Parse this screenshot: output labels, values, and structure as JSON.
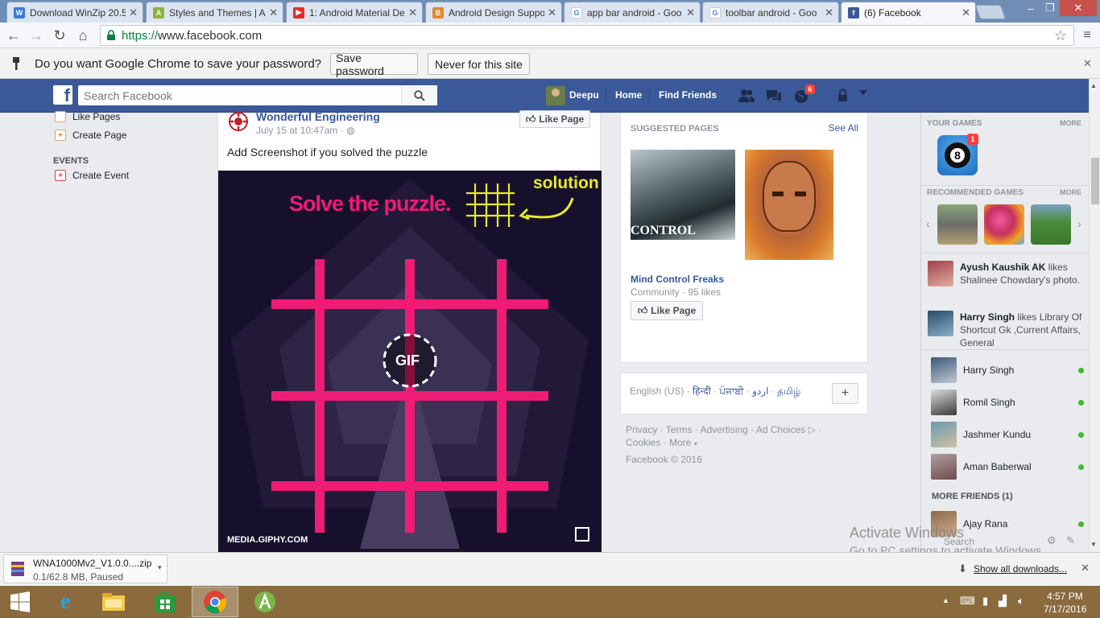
{
  "browser": {
    "tabs": [
      {
        "label": "Download WinZip 20.5",
        "icon": "winzip-icon",
        "color": "#3b7bd4"
      },
      {
        "label": "Styles and Themes | A",
        "icon": "android-icon",
        "color": "#8bb43a"
      },
      {
        "label": "1: Android Material De",
        "icon": "youtube-icon",
        "color": "#e52d27"
      },
      {
        "label": "Android Design Suppo",
        "icon": "blogger-icon",
        "color": "#e08a2b"
      },
      {
        "label": "app bar android - Goo",
        "icon": "google-icon",
        "color": "#4285f4"
      },
      {
        "label": "toolbar android - Goo",
        "icon": "google-icon",
        "color": "#4285f4"
      },
      {
        "label": "(6) Facebook",
        "icon": "facebook-icon",
        "color": "#3b5998"
      }
    ],
    "url_scheme": "https://",
    "url_host": "www.facebook.com",
    "password_prompt": "Do you want Google Chrome to save your password?",
    "save_password": "Save password",
    "never_for_site": "Never for this site"
  },
  "fb": {
    "search_placeholder": "Search Facebook",
    "user_name": "Deepu",
    "home": "Home",
    "find_friends": "Find Friends",
    "notif_count": "6"
  },
  "left": {
    "like_pages": "Like Pages",
    "create_page": "Create Page",
    "events_header": "EVENTS",
    "create_event": "Create Event"
  },
  "post": {
    "page_name": "Wonderful Engineering",
    "time": "July 15 at 10:47am",
    "like_page": "Like Page",
    "text": "Add Screenshot if you solved the puzzle",
    "puzzle_title": "Solve the puzzle.",
    "solution": "solution",
    "gif_label": "GIF",
    "source": "MEDIA.GIPHY.COM"
  },
  "suggested": {
    "header": "SUGGESTED PAGES",
    "see_all": "See All",
    "img_caption": "CONTROL",
    "page_name": "Mind Control Freaks",
    "category": "Community · 95 likes",
    "like_page": "Like Page"
  },
  "languages": {
    "current": "English (US)",
    "others": [
      "हिन्दी",
      "ਪੰਜਾਬੀ",
      "اردو",
      "தமிழ்"
    ],
    "add": "+"
  },
  "footer": {
    "links": [
      "Privacy",
      "Terms",
      "Advertising",
      "Ad Choices",
      "Cookies",
      "More"
    ],
    "copyright": "Facebook © 2016"
  },
  "games": {
    "your_games": "YOUR GAMES",
    "more": "MORE",
    "badge": "1",
    "recommended": "RECOMMENDED GAMES"
  },
  "ticker": [
    {
      "name": "Ayush Kaushik AK",
      "text": " likes Shalinee Chowdary's photo."
    },
    {
      "name": "Harry Singh",
      "text": " likes Library Of Shortcut Gk ,Current Affairs, General"
    }
  ],
  "chat": {
    "friends": [
      "Harry Singh",
      "Romil Singh",
      "Jashmer Kundu",
      "Aman Baberwal"
    ],
    "more_friends": "MORE FRIENDS (1)",
    "more_friend_name": "Ajay Rana",
    "search": "Search"
  },
  "watermark": {
    "line1": "Activate Windows",
    "line2": "Go to PC settings to activate Windows."
  },
  "download": {
    "filename": "WNA1000Mv2_V1.0.0....zip",
    "status": "0.1/62.8 MB, Paused",
    "show_all": "Show all downloads..."
  },
  "taskbar": {
    "time": "4:57 PM",
    "date": "7/17/2016"
  }
}
